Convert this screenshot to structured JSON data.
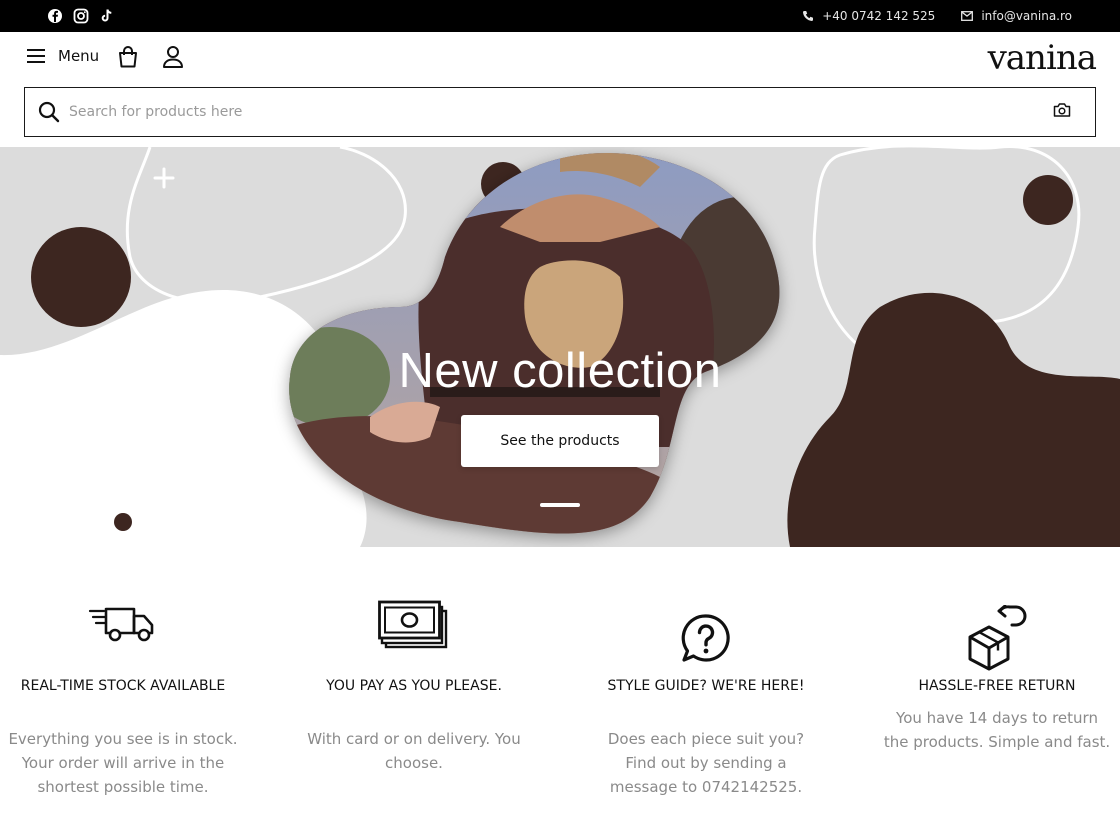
{
  "topbar": {
    "social": [
      "facebook-icon",
      "instagram-icon",
      "tiktok-icon"
    ],
    "phone": "+40 0742 142 525",
    "email": "info@vanina.ro"
  },
  "header": {
    "menu_label": "Menu",
    "logo": "vanina"
  },
  "search": {
    "placeholder": "Search for products here"
  },
  "hero": {
    "title": "New collection",
    "button_label": "See the products",
    "slide_count": 1,
    "active_slide": 1
  },
  "features": [
    {
      "icon": "delivery-truck-icon",
      "title": "REAL-TIME STOCK AVAILABLE",
      "text": "Everything you see is in stock. Your order will arrive in the shortest possible time."
    },
    {
      "icon": "cash-icon",
      "title": "YOU PAY AS YOU PLEASE.",
      "text": "With card or on delivery. You choose."
    },
    {
      "icon": "question-chat-icon",
      "title": "STYLE GUIDE? WE'RE HERE!",
      "text": "Does each piece suit you? Find out by sending a message to 0742142525."
    },
    {
      "icon": "return-box-icon",
      "title": "HASSLE-FREE RETURN",
      "text": "You have 14 days to return the products. Simple and fast."
    }
  ],
  "colors": {
    "topbar": "#000000",
    "hero_background": "#dcdcdc",
    "accent_brown": "#3d2620",
    "muted_text": "#8a8a8a"
  }
}
